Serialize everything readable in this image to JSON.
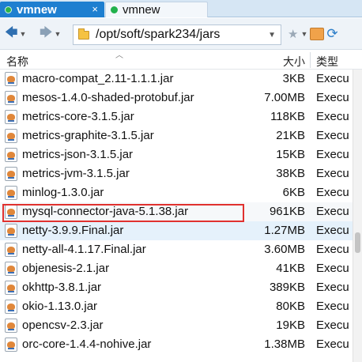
{
  "tabs": [
    {
      "label": "vmnew",
      "active": true,
      "close": "×"
    },
    {
      "label": "vmnew",
      "active": false
    }
  ],
  "toolbar": {
    "back_icon": "left-arrow",
    "forward_icon": "right-arrow",
    "address": "/opt/soft/spark234/jars",
    "colors": {
      "accent": "#1e7fd0",
      "tab_dot": "#2bb34a",
      "highlight_border": "#e0312f"
    }
  },
  "columns": {
    "name": "名称",
    "size": "大小",
    "type": "类型"
  },
  "files": [
    {
      "name": "macro-compat_2.11-1.1.1.jar",
      "size": "3KB",
      "type": "Execu"
    },
    {
      "name": "mesos-1.4.0-shaded-protobuf.jar",
      "size": "7.00MB",
      "type": "Execu"
    },
    {
      "name": "metrics-core-3.1.5.jar",
      "size": "118KB",
      "type": "Execu"
    },
    {
      "name": "metrics-graphite-3.1.5.jar",
      "size": "21KB",
      "type": "Execu"
    },
    {
      "name": "metrics-json-3.1.5.jar",
      "size": "15KB",
      "type": "Execu"
    },
    {
      "name": "metrics-jvm-3.1.5.jar",
      "size": "38KB",
      "type": "Execu"
    },
    {
      "name": "minlog-1.3.0.jar",
      "size": "6KB",
      "type": "Execu"
    },
    {
      "name": "mysql-connector-java-5.1.38.jar",
      "size": "961KB",
      "type": "Execu"
    },
    {
      "name": "netty-3.9.9.Final.jar",
      "size": "1.27MB",
      "type": "Execu"
    },
    {
      "name": "netty-all-4.1.17.Final.jar",
      "size": "3.60MB",
      "type": "Execu"
    },
    {
      "name": "objenesis-2.1.jar",
      "size": "41KB",
      "type": "Execu"
    },
    {
      "name": "okhttp-3.8.1.jar",
      "size": "389KB",
      "type": "Execu"
    },
    {
      "name": "okio-1.13.0.jar",
      "size": "80KB",
      "type": "Execu"
    },
    {
      "name": "opencsv-2.3.jar",
      "size": "19KB",
      "type": "Execu"
    },
    {
      "name": "orc-core-1.4.4-nohive.jar",
      "size": "1.38MB",
      "type": "Execu"
    }
  ]
}
